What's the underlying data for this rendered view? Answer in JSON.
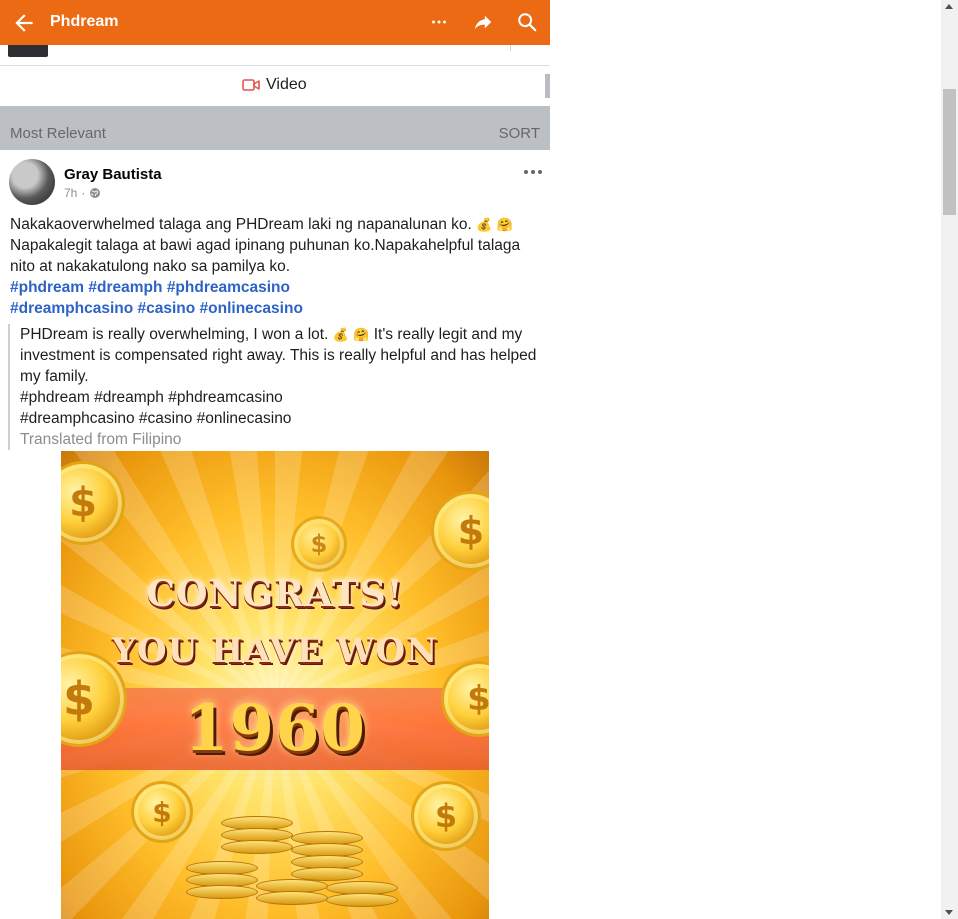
{
  "header": {
    "title": "Phdream",
    "icons": [
      "back-arrow-icon",
      "more-icon",
      "share-icon",
      "search-icon"
    ],
    "color": "#ec6a14"
  },
  "video_tab": {
    "label": "Video",
    "icon": "video-camera-icon"
  },
  "sort_bar": {
    "label": "Most Relevant",
    "action": "SORT"
  },
  "post": {
    "author": "Gray Bautista",
    "time": "7h",
    "separator": "·",
    "audience_icon": "globe-icon",
    "text_line1": "Nakakaoverwhelmed talaga ang PHDream laki ng napanalunan ko.",
    "emoji_a": "💰",
    "emoji_b": "🤗",
    "text_line2": "Napakalegit talaga at bawi agad ipinang puhunan ko.Napakahelpful talaga nito at nakakatulong nako sa pamilya ko.",
    "hashtags_row1": [
      "#phdream",
      "#dreamph",
      "#phdreamcasino"
    ],
    "hashtags_row2": [
      "#dreamphcasino",
      "#casino",
      "#onlinecasino"
    ],
    "translation": {
      "text_a": "PHDream is really overwhelming, I won a lot.",
      "text_b": "It's really legit and my investment is compensated right away. This is really helpful and has helped my family.",
      "hashtags_row1": "#phdream #dreamph #phdreamcasino",
      "hashtags_row2": "#dreamphcasino #casino #onlinecasino",
      "source": "Translated from Filipino"
    },
    "image": {
      "line1": "CONGRATS!",
      "line2": "YOU HAVE WON",
      "amount": "1960"
    }
  },
  "coin_symbol": "$"
}
